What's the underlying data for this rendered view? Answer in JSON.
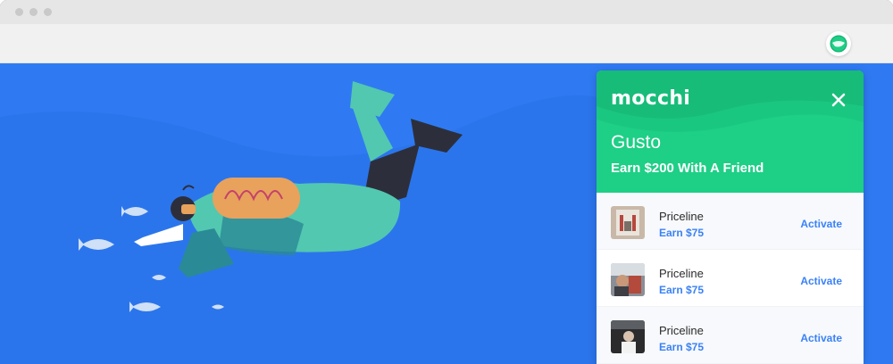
{
  "extension": {
    "icon": "mocchi-icon",
    "accent": "#1ecf86"
  },
  "page": {
    "background": "#2f7af2",
    "illustration": "scuba-diver-with-fish"
  },
  "popup": {
    "logo": "mocchi",
    "close_icon": "close-icon",
    "merchant": "Gusto",
    "headline": "Earn $200 With A Friend",
    "offers": [
      {
        "name": "Priceline",
        "earn": "Earn $75",
        "action": "Activate"
      },
      {
        "name": "Priceline",
        "earn": "Earn $75",
        "action": "Activate"
      },
      {
        "name": "Priceline",
        "earn": "Earn $75",
        "action": "Activate"
      }
    ],
    "link_color": "#3b82f6"
  }
}
